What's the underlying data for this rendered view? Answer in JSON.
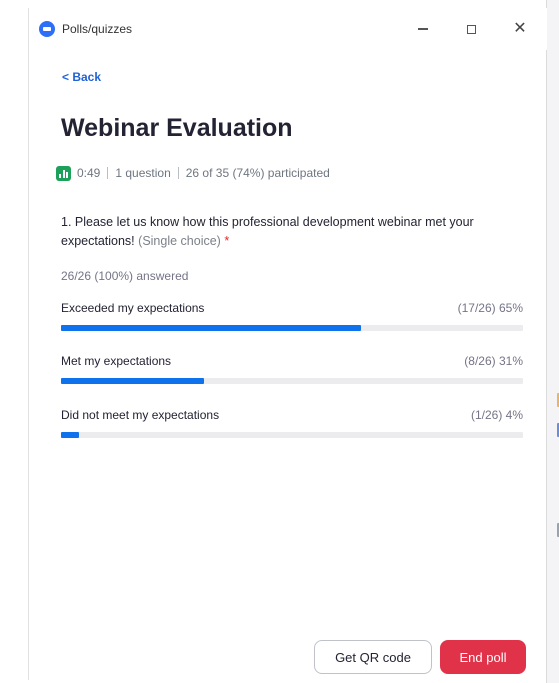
{
  "window": {
    "title": "Polls/quizzes",
    "minimize_glyph": "—",
    "maximize_glyph": "☐",
    "close_glyph": "✕"
  },
  "nav": {
    "back_label": "< Back"
  },
  "poll": {
    "title": "Webinar Evaluation",
    "elapsed": "0:49",
    "question_count": "1 question",
    "participation": "26 of 35 (74%) participated"
  },
  "question": {
    "text": "1. Please let us know how this professional development webinar met your expectations!",
    "hint": "(Single choice)",
    "required_mark": "*",
    "answered": "26/26 (100%) answered",
    "options": [
      {
        "label": "Exceeded my expectations",
        "stat": "(17/26) 65%",
        "fraction": 0.65
      },
      {
        "label": "Met my expectations",
        "stat": "(8/26) 31%",
        "fraction": 0.31
      },
      {
        "label": "Did not meet my expectations",
        "stat": "(1/26) 4%",
        "fraction": 0.04
      }
    ]
  },
  "actions": {
    "qr_label": "Get QR code",
    "end_label": "End poll"
  },
  "colors": {
    "accent": "#0e72ed",
    "danger": "#e0334a",
    "poll_icon": "#1da15a",
    "link": "#1f62d8"
  },
  "icons": {
    "app": "zoom-app-icon",
    "poll": "bar-chart-icon"
  }
}
